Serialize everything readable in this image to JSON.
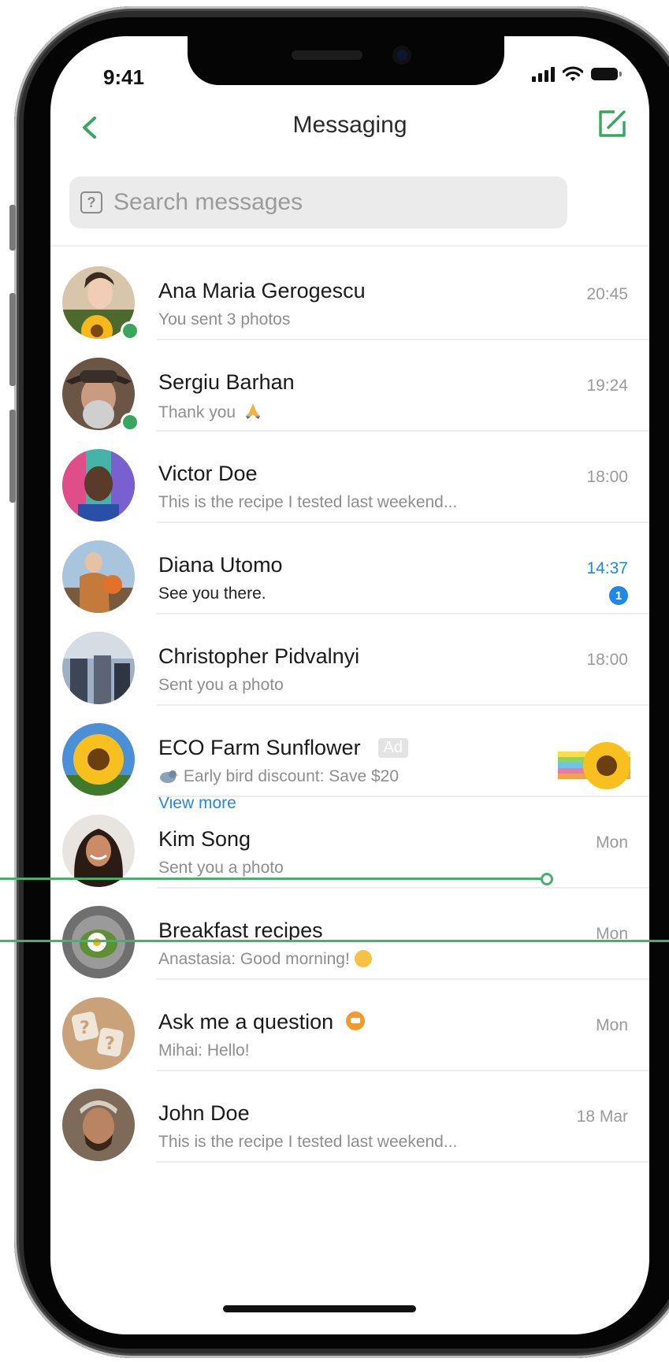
{
  "status_bar": {
    "time": "9:41"
  },
  "header": {
    "title": "Messaging"
  },
  "search": {
    "placeholder": "Search messages",
    "icon_glyph": "?"
  },
  "icons": {
    "back": "chevron-left-icon",
    "compose": "compose-icon",
    "search": "search-icon"
  },
  "colors": {
    "accent_green": "#37a75d",
    "unread_blue": "#1e88e5",
    "online_green": "#37a75d"
  },
  "conversations": [
    {
      "name": "Ana Maria Gerogescu",
      "preview": "You sent 3 photos",
      "time": "20:45",
      "online": true
    },
    {
      "name": "Sergiu Barhan",
      "preview": "Thank you",
      "time": "19:24",
      "online": true,
      "emoji": "pray-icon"
    },
    {
      "name": "Victor Doe",
      "preview": "This is the recipe I tested last weekend...",
      "time": "18:00"
    },
    {
      "name": "Diana Utomo",
      "preview": "See you there.",
      "time": "14:37",
      "unread_count": "1"
    },
    {
      "name": "Christopher Pidvalnyi",
      "preview": "Sent you a photo",
      "time": "18:00"
    },
    {
      "name": "ECO Farm Sunflower",
      "badge": "Ad",
      "preview": "Early bird discount: Save $20",
      "link": "View more"
    },
    {
      "name": "Kim Song",
      "preview": "Sent you a photo",
      "time": "Mon"
    },
    {
      "name": "Breakfast recipes",
      "preview": "Anastasia: Good morning!",
      "time": "Mon",
      "emoji": "smile-icon"
    },
    {
      "name": "Ask me a question",
      "preview": "Mihai: Hello!",
      "time": "Mon",
      "owner_badge": "crown-badge-icon"
    },
    {
      "name": "John Doe",
      "preview": "This is the recipe I tested last weekend...",
      "time": "18 Mar"
    }
  ]
}
